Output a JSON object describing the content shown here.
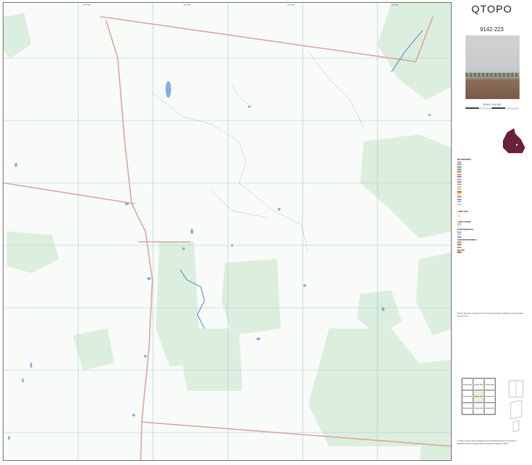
{
  "panel": {
    "title": "QTOPO",
    "sheet_number": "9142-223",
    "scale_text": "SCALE 1:10,000",
    "photo_caption": ""
  },
  "map": {
    "grid_labels_top": [
      "147°30'",
      "147°35'",
      "147°40'",
      "147°45'"
    ],
    "colors": {
      "background": "#f8fbf8",
      "vegetation": "#dceedd",
      "road": "#d9a39b",
      "water": "#7fb2e0",
      "grid": "#9cc3e6",
      "creek": "#5f95cc"
    }
  },
  "legend": {
    "sections": [
      "BOUNDARIES",
      "LAND USE",
      "LAND COVER",
      "HYDROGRAPHY",
      "TRANSPORTATION",
      "RELIEF"
    ]
  },
  "sheet_index": [
    "9142-222",
    "9142-223",
    "9142-224",
    "9142-212",
    "9142-213",
    "9142-214",
    "9142-232",
    "9142-233",
    "9142-234"
  ],
  "footer": {
    "disclaimer": "QTopo has been compiled from the best information available to Queensland Government.",
    "copyright": "© State of Queensland (Department of Natural Resources and Mines, Manufacturing and Regional and Rural Development) 2025"
  }
}
